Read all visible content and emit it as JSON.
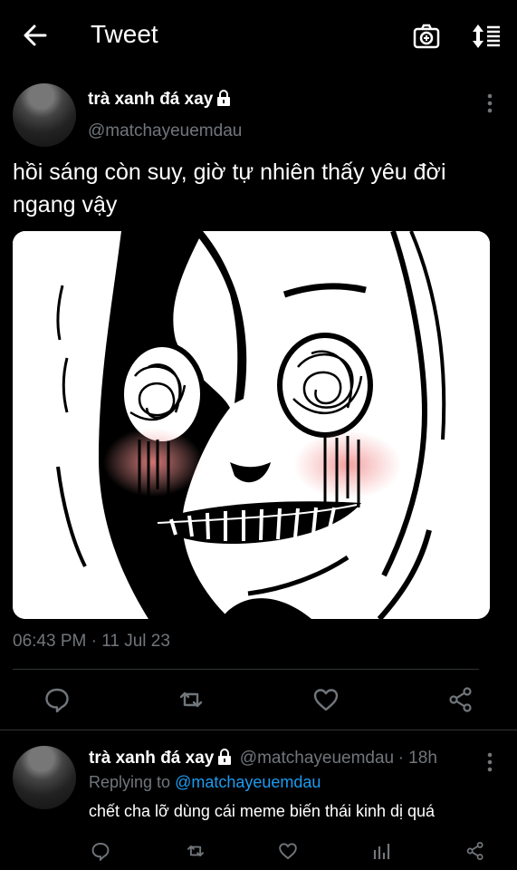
{
  "header": {
    "title": "Tweet"
  },
  "tweet": {
    "author_name": "trà xanh đá xay",
    "author_handle": "@matchayeuemdau",
    "text": "hồi sáng còn suy, giờ tự nhiên thấy yêu đời ngang vậy",
    "timestamp": "06:43 PM · 11 Jul 23"
  },
  "reply": {
    "author_name": "trà xanh đá xay",
    "author_handle": "@matchayeuemdau",
    "age": "· 18h",
    "replying_prefix": "Replying to ",
    "replying_to": "@matchayeuemdau",
    "text": "chết cha lỡ dùng cái meme biến thái kinh dị quá"
  },
  "icons": {
    "back": "arrow-left-icon",
    "camera": "camera-icon",
    "sort": "sort-icon",
    "more": "more-vertical-icon",
    "lock": "lock-icon",
    "reply": "comment-icon",
    "retweet": "retweet-icon",
    "like": "heart-icon",
    "share": "share-icon",
    "analytics": "analytics-icon"
  },
  "colors": {
    "background": "#000000",
    "text": "#e7e9ea",
    "muted": "#71767b",
    "link": "#1d9bf0"
  }
}
